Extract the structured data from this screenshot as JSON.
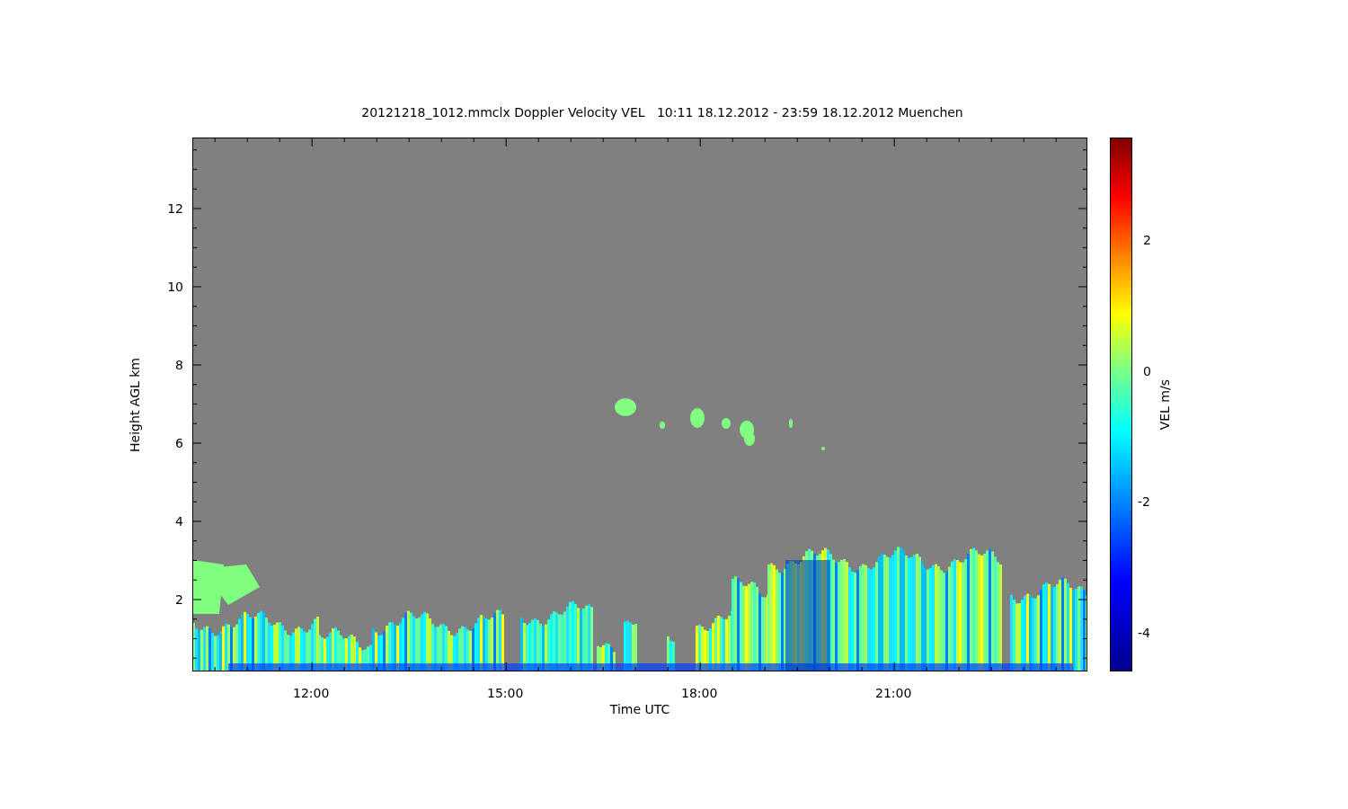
{
  "title": "20121218_1012.mmclx Doppler Velocity VEL   10:11 18.12.2012 - 23:59 18.12.2012 Muenchen",
  "plot": {
    "ylabel": "Height AGL km",
    "yticks": [
      "12",
      "10",
      "8",
      "6",
      "4",
      "2"
    ],
    "xlabel": "Time UTC",
    "xticks": [
      "12:00",
      "15:00",
      "18:00",
      "21:00"
    ]
  },
  "colorbar": {
    "label": "VEL m/s",
    "ticks": [
      "2",
      "0",
      "-2",
      "-4"
    ]
  }
}
